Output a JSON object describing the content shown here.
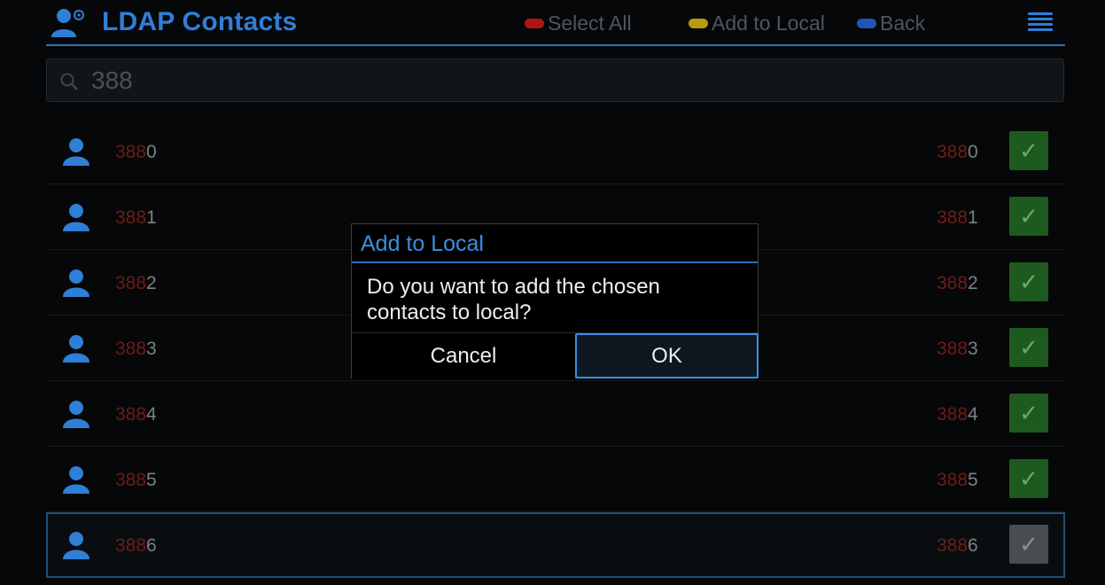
{
  "header": {
    "title": "LDAP Contacts",
    "icon": "contacts-settings-icon",
    "softkeys": [
      {
        "label": "Select All",
        "color": "#b01515"
      },
      {
        "label": "Add to Local",
        "color": "#b59a14"
      },
      {
        "label": "Back",
        "color": "#1f55b5"
      }
    ],
    "menu_icon": "menu-icon"
  },
  "search": {
    "value": "388",
    "icon": "search-icon"
  },
  "contacts": [
    {
      "name_match": "388",
      "name_rest": "0",
      "number_match": "388",
      "number_rest": "0",
      "checked": true
    },
    {
      "name_match": "388",
      "name_rest": "1",
      "number_match": "388",
      "number_rest": "1",
      "checked": true
    },
    {
      "name_match": "388",
      "name_rest": "2",
      "number_match": "388",
      "number_rest": "2",
      "checked": true
    },
    {
      "name_match": "388",
      "name_rest": "3",
      "number_match": "388",
      "number_rest": "3",
      "checked": true
    },
    {
      "name_match": "388",
      "name_rest": "4",
      "number_match": "388",
      "number_rest": "4",
      "checked": true
    },
    {
      "name_match": "388",
      "name_rest": "5",
      "number_match": "388",
      "number_rest": "5",
      "checked": true
    },
    {
      "name_match": "388",
      "name_rest": "6",
      "number_match": "388",
      "number_rest": "6",
      "checked": true
    }
  ],
  "dialog": {
    "title": "Add to Local",
    "message": "Do you want to add the chosen contacts to local?",
    "cancel_label": "Cancel",
    "ok_label": "OK"
  },
  "colors": {
    "accent": "#2e7fd6",
    "match_highlight": "#6e1c18",
    "checkbox_checked": "#1e5a1f"
  }
}
